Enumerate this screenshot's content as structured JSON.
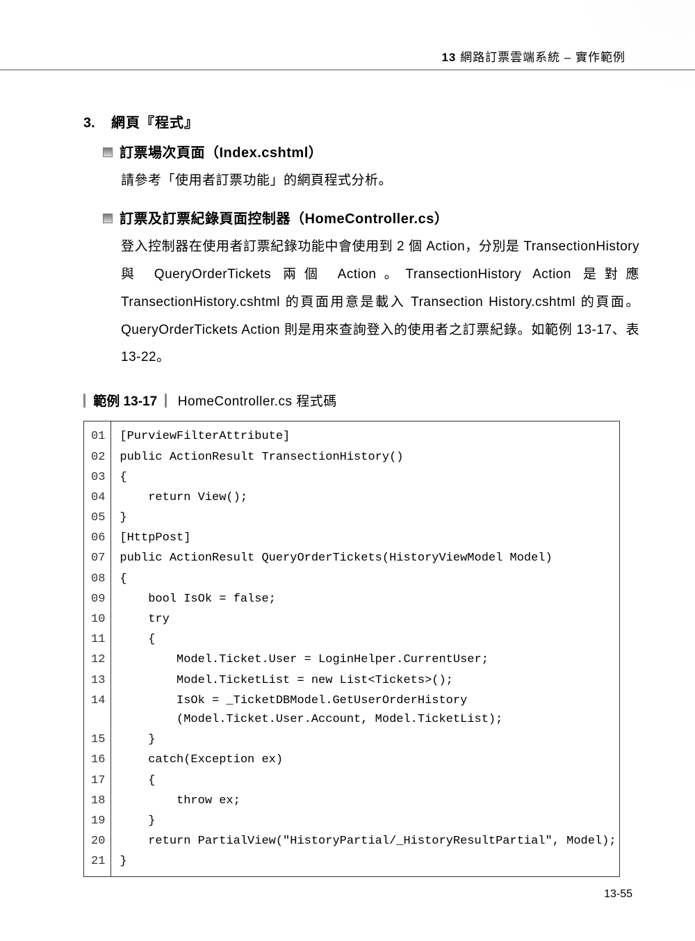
{
  "header": {
    "chapter_num": "13",
    "chapter_title": "網路訂票雲端系統 – 實作範例"
  },
  "section": {
    "number": "3.",
    "title": "網頁『程式』"
  },
  "bullets": [
    {
      "title": "訂票場次頁面（Index.cshtml）",
      "para": "請參考「使用者訂票功能」的網頁程式分析。"
    },
    {
      "title": "訂票及訂票紀錄頁面控制器（HomeController.cs）",
      "para": "登入控制器在使用者訂票紀錄功能中會使用到 2 個 Action，分別是 TransectionHistory 與 QueryOrderTickets 兩個 Action。TransectionHistory Action 是對應 TransectionHistory.cshtml 的頁面用意是載入 Transection History.cshtml 的頁面。QueryOrderTickets Action 則是用來查詢登入的使用者之訂票紀錄。如範例 13-17、表 13-22。"
    }
  ],
  "example": {
    "label": "範例 13-17",
    "caption": "HomeController.cs 程式碼"
  },
  "code_lines": [
    {
      "n": "01",
      "c": "[PurviewFilterAttribute]"
    },
    {
      "n": "02",
      "c": "public ActionResult TransectionHistory()"
    },
    {
      "n": "03",
      "c": "{"
    },
    {
      "n": "04",
      "c": "    return View();"
    },
    {
      "n": "05",
      "c": "}"
    },
    {
      "n": "06",
      "c": "[HttpPost]"
    },
    {
      "n": "07",
      "c": "public ActionResult QueryOrderTickets(HistoryViewModel Model)"
    },
    {
      "n": "08",
      "c": "{"
    },
    {
      "n": "09",
      "c": "    bool IsOk = false;"
    },
    {
      "n": "10",
      "c": "    try"
    },
    {
      "n": "11",
      "c": "    {"
    },
    {
      "n": "12",
      "c": "        Model.Ticket.User = LoginHelper.CurrentUser;"
    },
    {
      "n": "13",
      "c": "        Model.TicketList = new List<Tickets>();"
    },
    {
      "n": "14",
      "c": "        IsOk = _TicketDBModel.GetUserOrderHistory\n        (Model.Ticket.User.Account, Model.TicketList);"
    },
    {
      "n": "15",
      "c": "    }"
    },
    {
      "n": "16",
      "c": "    catch(Exception ex)"
    },
    {
      "n": "17",
      "c": "    {"
    },
    {
      "n": "18",
      "c": "        throw ex;"
    },
    {
      "n": "19",
      "c": "    }"
    },
    {
      "n": "20",
      "c": "    return PartialView(\"HistoryPartial/_HistoryResultPartial\", Model);"
    },
    {
      "n": "21",
      "c": "}"
    }
  ],
  "page_number": "13-55"
}
